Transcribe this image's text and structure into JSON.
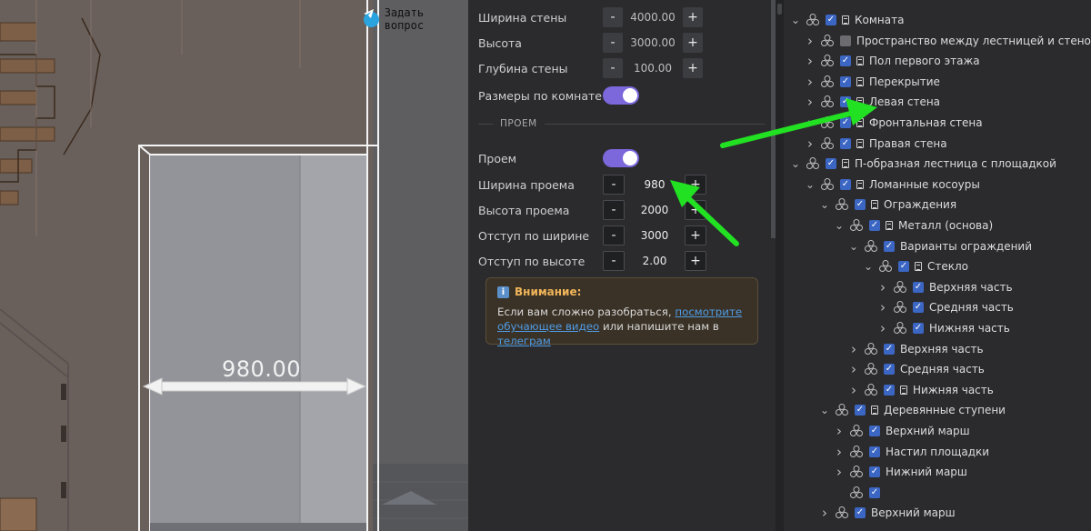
{
  "viewport": {
    "ask_button_label": "Задать вопрос",
    "dimension_label": "980.00"
  },
  "props": {
    "wall_width": {
      "label": "Ширина стены",
      "value": "4000.00"
    },
    "height": {
      "label": "Высота",
      "value": "3000.00"
    },
    "wall_depth": {
      "label": "Глубина стены",
      "value": "100.00"
    },
    "room_dims": {
      "label": "Размеры по комнате",
      "on": true
    },
    "section_title": "ПРОЕМ",
    "opening": {
      "label": "Проем",
      "on": true
    },
    "opening_width": {
      "label": "Ширина проема",
      "value": "980"
    },
    "opening_height": {
      "label": "Высота проема",
      "value": "2000"
    },
    "offset_width": {
      "label": "Отступ по ширине",
      "value": "3000"
    },
    "offset_height": {
      "label": "Отступ по высоте",
      "value": "2.00"
    },
    "minus": "-",
    "plus": "+"
  },
  "notice": {
    "title": "Внимание:",
    "text_before": "Если вам сложно разобраться, ",
    "link_video": "посмотрите обучающее видео",
    "text_middle": " или напишите нам в ",
    "link_telegram": "телеграм"
  },
  "tree": [
    {
      "label": "Комната",
      "chev": "down",
      "cube": true,
      "cb": "on",
      "doc": true
    },
    {
      "label": "Пространство между лестницей и стеной",
      "chev": "right",
      "cube": true,
      "cb": "off",
      "doc": false
    },
    {
      "label": "Пол первого этажа",
      "chev": "right",
      "cube": true,
      "cb": "on",
      "doc": true
    },
    {
      "label": "Перекрытие",
      "chev": "right",
      "cube": true,
      "cb": "on",
      "doc": true
    },
    {
      "label": "Левая стена",
      "chev": "right",
      "cube": true,
      "cb": "on",
      "doc": true,
      "selected": true
    },
    {
      "label": "Фронтальная стена",
      "chev": "right",
      "cube": true,
      "cb": "on",
      "doc": true
    },
    {
      "label": "Правая стена",
      "chev": "right",
      "cube": true,
      "cb": "on",
      "doc": true
    },
    {
      "label": "П-образная лестница с площадкой",
      "chev": "down",
      "cube": true,
      "cb": "on",
      "doc": true
    },
    {
      "label": "Ломанные косоуры",
      "chev": "down",
      "cube": true,
      "cb": "on",
      "doc": true
    },
    {
      "label": "Ограждения",
      "chev": "down",
      "cube": true,
      "cb": "on",
      "doc": true
    },
    {
      "label": "Металл (основа)",
      "chev": "down",
      "cube": true,
      "cb": "on",
      "doc": true
    },
    {
      "label": "Варианты ограждений",
      "chev": "down",
      "cube": true,
      "cb": "on",
      "doc": false
    },
    {
      "label": "Стекло",
      "chev": "down",
      "cube": true,
      "cb": "on",
      "doc": true
    },
    {
      "label": "Верхняя часть",
      "chev": "right",
      "cube": true,
      "cb": "on",
      "doc": false
    },
    {
      "label": "Средняя часть",
      "chev": "right",
      "cube": true,
      "cb": "on",
      "doc": false
    },
    {
      "label": "Нижняя часть",
      "chev": "right",
      "cube": true,
      "cb": "on",
      "doc": false
    },
    {
      "label": "Верхняя часть",
      "chev": "right",
      "cube": true,
      "cb": "on",
      "doc": false
    },
    {
      "label": "Средняя часть",
      "chev": "right",
      "cube": true,
      "cb": "on",
      "doc": false
    },
    {
      "label": "Нижняя часть",
      "chev": "right",
      "cube": true,
      "cb": "on",
      "doc": true
    },
    {
      "label": "Деревянные ступени",
      "chev": "down",
      "cube": true,
      "cb": "on",
      "doc": true
    },
    {
      "label": "Верхний марш",
      "chev": "right",
      "cube": true,
      "cb": "on",
      "doc": false
    },
    {
      "label": "Настил площадки",
      "chev": "right",
      "cube": true,
      "cb": "on",
      "doc": false
    },
    {
      "label": "Нижний марш",
      "chev": "right",
      "cube": true,
      "cb": "on",
      "doc": false
    },
    {
      "label": "",
      "chev": "",
      "cube": true,
      "cb": "on",
      "doc": false
    },
    {
      "label": "Верхний марш",
      "chev": "right",
      "cube": true,
      "cb": "on",
      "doc": false
    }
  ],
  "colors": {
    "accent_toggle": "#7c67db",
    "checkbox": "#3b66c4",
    "annotation_arrow": "#22e022",
    "notice_title": "#f0b45a",
    "link": "#4f9be6"
  }
}
